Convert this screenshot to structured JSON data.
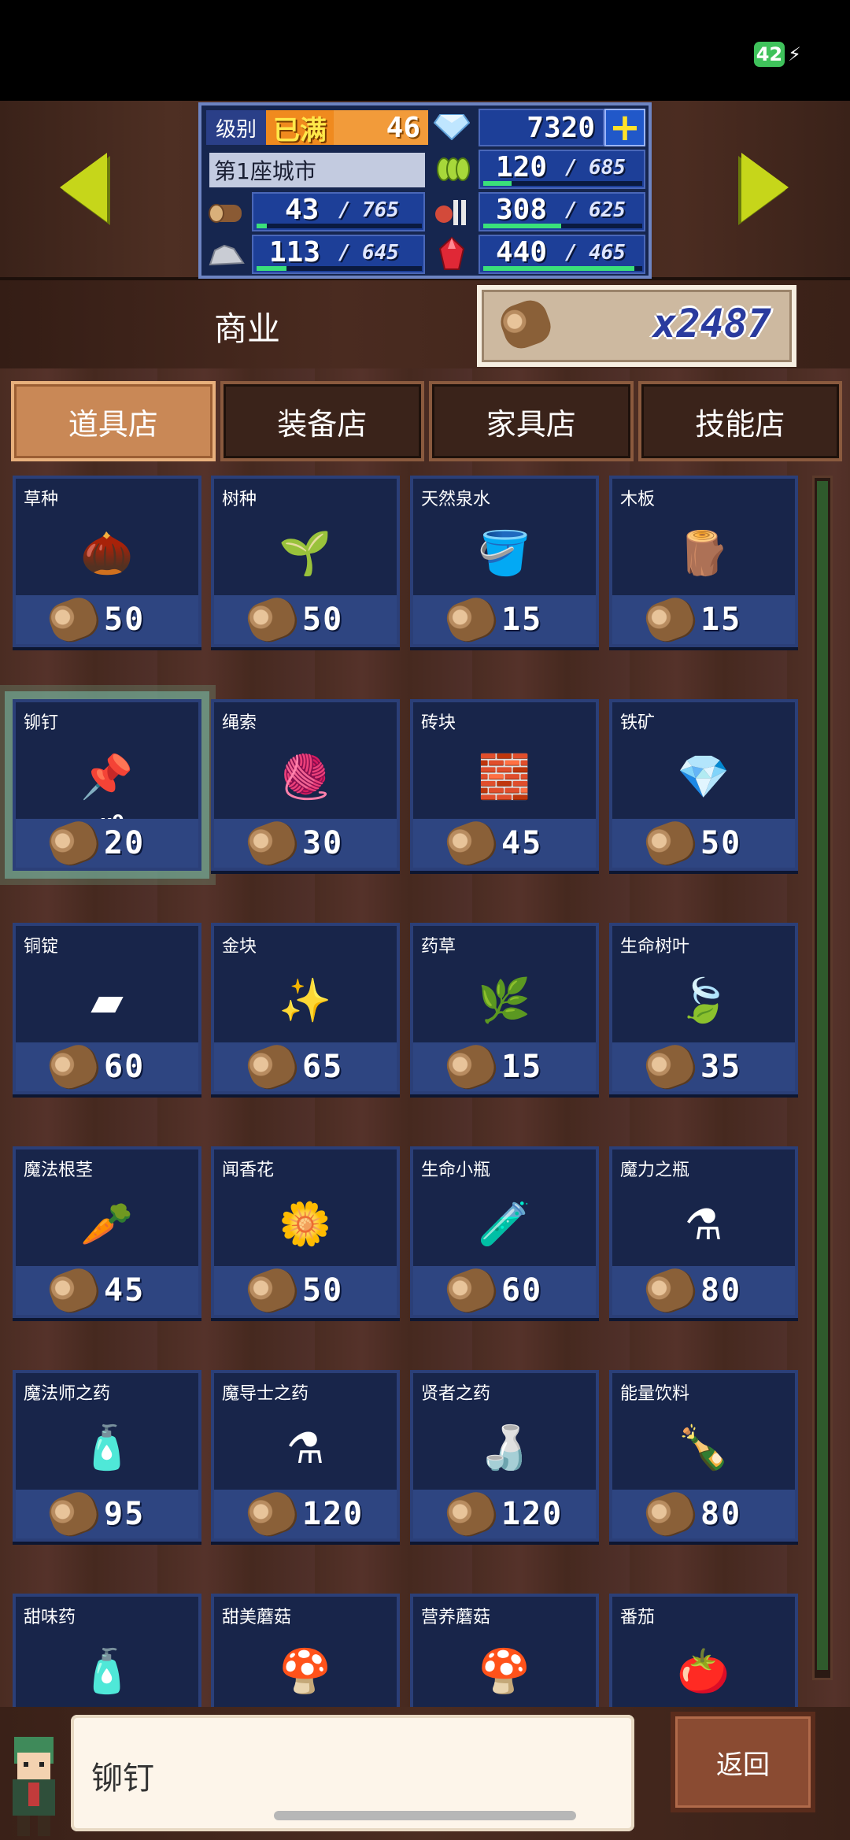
{
  "status": {
    "battery": "42"
  },
  "header": {
    "level_label": "级别",
    "level_status": "已满",
    "level": "46",
    "gems": "7320",
    "city_name": "第1座城市",
    "resources": [
      {
        "icon": "wood-icon",
        "value": "43",
        "max": "765",
        "fill": 0.06
      },
      {
        "icon": "stone-icon",
        "value": "113",
        "max": "645",
        "fill": 0.18
      },
      {
        "icon": "grain-icon",
        "value": "120",
        "max": "685",
        "fill": 0.18
      },
      {
        "icon": "food-icon",
        "value": "308",
        "max": "625",
        "fill": 0.49
      },
      {
        "icon": "ruby-icon",
        "value": "440",
        "max": "465",
        "fill": 0.95
      }
    ]
  },
  "business": {
    "title": "商业",
    "coins": "x2487"
  },
  "tabs": [
    {
      "label": "道具店",
      "active": true
    },
    {
      "label": "装备店",
      "active": false
    },
    {
      "label": "家具店",
      "active": false
    },
    {
      "label": "技能店",
      "active": false
    }
  ],
  "items": [
    {
      "name": "草种",
      "price": "50",
      "icon": "seed-icon",
      "glyph": "🌰"
    },
    {
      "name": "树种",
      "price": "50",
      "icon": "sprout-icon",
      "glyph": "🌱"
    },
    {
      "name": "天然泉水",
      "price": "15",
      "icon": "water-bucket-icon",
      "glyph": "🪣"
    },
    {
      "name": "木板",
      "price": "15",
      "icon": "plank-icon",
      "glyph": "🪵"
    },
    {
      "name": "铆钉",
      "price": "20",
      "icon": "rivet-icon",
      "glyph": "📌",
      "selected": true,
      "qty": "x0"
    },
    {
      "name": "绳索",
      "price": "30",
      "icon": "rope-icon",
      "glyph": "🧶"
    },
    {
      "name": "砖块",
      "price": "45",
      "icon": "brick-icon",
      "glyph": "🧱"
    },
    {
      "name": "铁矿",
      "price": "50",
      "icon": "iron-ore-icon",
      "glyph": "💎"
    },
    {
      "name": "铜锭",
      "price": "60",
      "icon": "copper-ingot-icon",
      "glyph": "▰"
    },
    {
      "name": "金块",
      "price": "65",
      "icon": "gold-nugget-icon",
      "glyph": "✨"
    },
    {
      "name": "药草",
      "price": "15",
      "icon": "herb-icon",
      "glyph": "🌿"
    },
    {
      "name": "生命树叶",
      "price": "35",
      "icon": "life-leaf-icon",
      "glyph": "🍃"
    },
    {
      "name": "魔法根茎",
      "price": "45",
      "icon": "magic-root-icon",
      "glyph": "🥕"
    },
    {
      "name": "闻香花",
      "price": "50",
      "icon": "flower-icon",
      "glyph": "🌼"
    },
    {
      "name": "生命小瓶",
      "price": "60",
      "icon": "life-potion-icon",
      "glyph": "🧪"
    },
    {
      "name": "魔力之瓶",
      "price": "80",
      "icon": "mana-bottle-icon",
      "glyph": "⚗"
    },
    {
      "name": "魔法师之药",
      "price": "95",
      "icon": "mage-potion-icon",
      "glyph": "🧴"
    },
    {
      "name": "魔导士之药",
      "price": "120",
      "icon": "sorcerer-potion-icon",
      "glyph": "⚗"
    },
    {
      "name": "贤者之药",
      "price": "120",
      "icon": "sage-potion-icon",
      "glyph": "🍶"
    },
    {
      "name": "能量饮料",
      "price": "80",
      "icon": "energy-drink-icon",
      "glyph": "🍾"
    },
    {
      "name": "甜味药",
      "price": "",
      "icon": "sweet-potion-icon",
      "glyph": "🧴"
    },
    {
      "name": "甜美蘑菇",
      "price": "",
      "icon": "sweet-mushroom-icon",
      "glyph": "🍄"
    },
    {
      "name": "营养蘑菇",
      "price": "",
      "icon": "nutrition-mushroom-icon",
      "glyph": "🍄"
    },
    {
      "name": "番茄",
      "price": "",
      "icon": "tomato-icon",
      "glyph": "🍅"
    }
  ],
  "dialog": {
    "text": "铆钉"
  },
  "back_label": "返回"
}
